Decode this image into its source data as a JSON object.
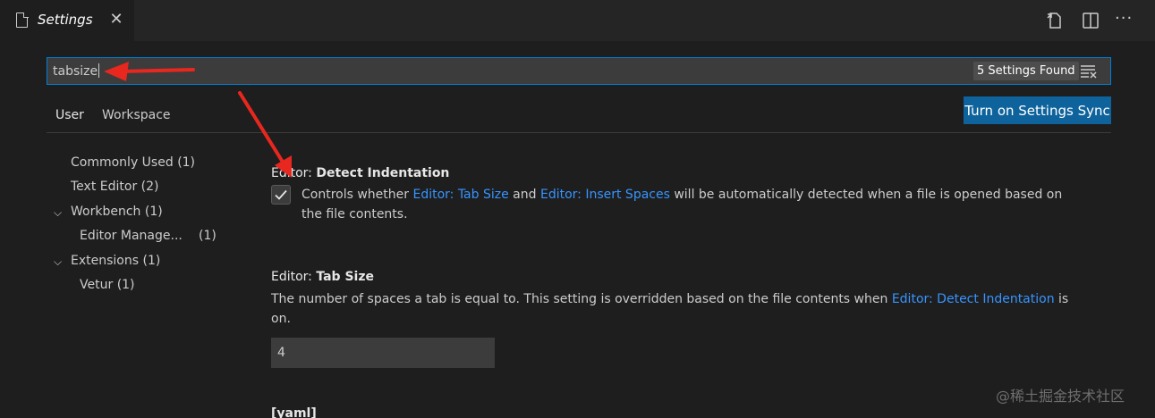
{
  "tab": {
    "title": "Settings"
  },
  "search": {
    "value": "tabsize",
    "count_label": "5 Settings Found"
  },
  "scopes": {
    "user": "User",
    "workspace": "Workspace"
  },
  "sync_button": "Turn on Settings Sync",
  "toc": [
    {
      "label": "Commonly Used",
      "count": "(1)"
    },
    {
      "label": "Text Editor",
      "count": "(2)"
    },
    {
      "label": "Workbench",
      "count": "(1)"
    },
    {
      "label": "Editor Manage...",
      "count": "(1)"
    },
    {
      "label": "Extensions",
      "count": "(1)"
    },
    {
      "label": "Vetur",
      "count": "(1)"
    }
  ],
  "settings": {
    "detect": {
      "category": "Editor: ",
      "name": "Detect Indentation",
      "desc_1": "Controls whether ",
      "link_1": "Editor: Tab Size",
      "desc_2": " and ",
      "link_2": "Editor: Insert Spaces",
      "desc_3": " will be automatically detected when a file is opened based on",
      "desc_4": "the file contents.",
      "checked": true
    },
    "tabsize": {
      "category": "Editor: ",
      "name": "Tab Size",
      "desc_1": "The number of spaces a tab is equal to. This setting is overridden based on the file contents when ",
      "link_1": "Editor: Detect Indentation",
      "desc_2": " is",
      "desc_3": "on.",
      "value": "4"
    },
    "yaml": {
      "title": "[yaml]"
    }
  },
  "watermark": "@稀土掘金技术社区",
  "icons": {
    "file": "file-icon",
    "close": "close-icon",
    "open_json": "open-json-icon",
    "split": "split-editor-icon",
    "more": "more-icon",
    "clear": "clear-filter-icon",
    "chevron": "chevron-down-icon",
    "check": "check-icon"
  },
  "colors": {
    "accent": "#007fd4",
    "button": "#0e639c",
    "link": "#3794ff",
    "annotation": "#e8271f"
  }
}
